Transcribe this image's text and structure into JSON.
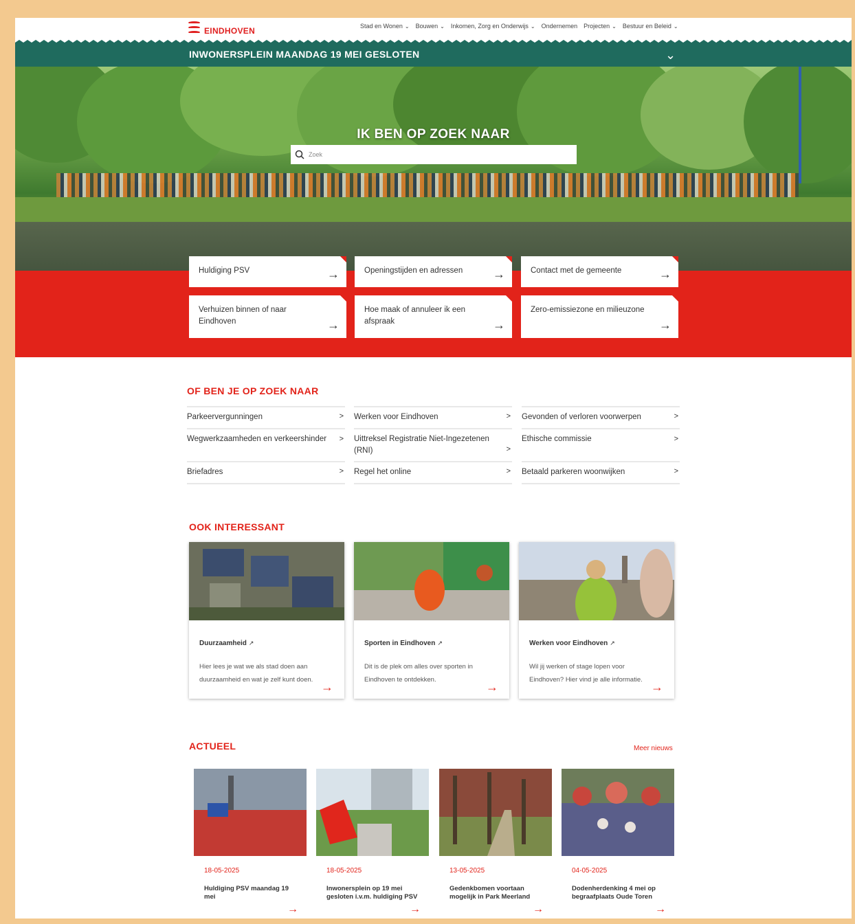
{
  "header": {
    "logo_text": "EINDHOVEN",
    "nav": [
      {
        "label": "Stad en Wonen",
        "dropdown": true
      },
      {
        "label": "Bouwen",
        "dropdown": true
      },
      {
        "label": "Inkomen, Zorg en Onderwijs",
        "dropdown": true
      },
      {
        "label": "Ondernemen",
        "dropdown": false
      },
      {
        "label": "Projecten",
        "dropdown": true
      },
      {
        "label": "Bestuur en Beleid",
        "dropdown": true
      }
    ]
  },
  "notice": {
    "title": "INWONERSPLEIN MAANDAG 19 MEI GESLOTEN",
    "toggle_icon": "chevron-down-icon"
  },
  "hero": {
    "heading": "IK BEN OP ZOEK NAAR",
    "search_placeholder": "Zoek",
    "search_value": ""
  },
  "quick_links": [
    {
      "label": "Huldiging PSV"
    },
    {
      "label": "Openingstijden en adressen"
    },
    {
      "label": "Contact met de gemeente"
    },
    {
      "label": "Verhuizen binnen of naar Eindhoven"
    },
    {
      "label": "Hoe maak of annuleer ik een afspraak"
    },
    {
      "label": "Zero-emissiezone en milieuzone"
    }
  ],
  "of_ben_je": {
    "heading": "OF BEN JE OP ZOEK NAAR",
    "columns": [
      [
        "Parkeervergunningen",
        "Wegwerkzaamheden en verkeershinder",
        "Briefadres"
      ],
      [
        "Werken voor Eindhoven",
        "Uittreksel Registratie Niet-Ingezetenen (RNI)",
        "Regel het online"
      ],
      [
        "Gevonden of verloren voorwerpen",
        "Ethische commissie",
        "Betaald parkeren woonwijken"
      ]
    ]
  },
  "ook_interessant": {
    "heading": "OOK INTERESSANT",
    "cards": [
      {
        "title": "Duurzaamheid",
        "description": "Hier lees je wat we als stad doen aan duurzaamheid en wat je zelf kunt doen."
      },
      {
        "title": "Sporten in Eindhoven",
        "description": "Dit is de plek om alles over sporten in Eindhoven te ontdekken."
      },
      {
        "title": "Werken voor Eindhoven",
        "description": "Wil jij werken of stage lopen voor Eindhoven? Hier vind je alle informatie."
      }
    ]
  },
  "actueel": {
    "heading": "ACTUEEL",
    "meer_label": "Meer nieuws",
    "items": [
      {
        "date": "18-05-2025",
        "title": "Huldiging PSV maandag 19 mei"
      },
      {
        "date": "18-05-2025",
        "title": "Inwonersplein op 19 mei gesloten i.v.m. huldiging PSV"
      },
      {
        "date": "13-05-2025",
        "title": "Gedenkbomen voortaan mogelijk in Park Meerland"
      },
      {
        "date": "04-05-2025",
        "title": "Dodenherdenking 4 mei op begraafplaats Oude Toren"
      }
    ]
  },
  "colors": {
    "brand_red": "#e2231a",
    "notice_green": "#1f6b5e",
    "outer_border": "#f3c98f"
  }
}
